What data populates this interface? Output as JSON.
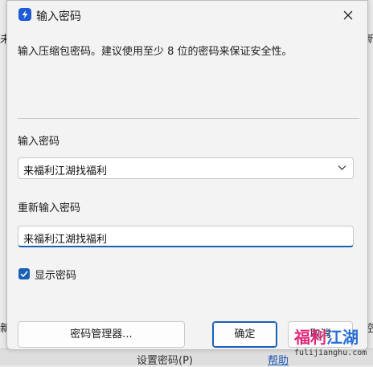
{
  "background": {
    "left_top": "未",
    "right_top": "新",
    "left_bottom": "新",
    "right_bottom": "控",
    "bottom_text": "设置密码(P)",
    "bottom_link": "帮助"
  },
  "dialog": {
    "title": "输入密码",
    "description": "输入压缩包密码。建议使用至少 8 位的密码来保证安全性。",
    "password_label": "输入密码",
    "password_value": "来福利江湖找福利",
    "reenter_label": "重新输入密码",
    "reenter_value": "来福利江湖找福利",
    "show_password_label": "显示密码",
    "show_password_checked": true,
    "manager_button": "密码管理器...",
    "ok_button": "确定",
    "cancel_button": "取消"
  },
  "watermark": {
    "part1": "福利",
    "part2": "江湖",
    "url": "fulijianghu.com"
  },
  "colors": {
    "accent": "#1a5fb4",
    "app_icon": "#1e5bd8",
    "watermark_pink": "#e2287a",
    "watermark_blue": "#2a6fd6"
  }
}
